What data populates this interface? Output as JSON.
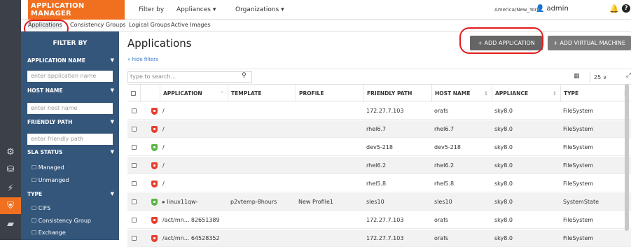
{
  "app": {
    "title": "APPLICATION MANAGER"
  },
  "topnav": {
    "filter_by": "Filter by",
    "appliances": "Appliances ▾",
    "organizations": "Organizations ▾",
    "timezone": "America/New_York",
    "user": "admin"
  },
  "subnav": {
    "tabs": [
      "Applications",
      "Consistency Groups",
      "Logical Groups",
      "Active Images"
    ]
  },
  "filters": {
    "title": "FILTER BY",
    "sections": [
      {
        "label": "APPLICATION NAME",
        "placeholder": "enter application name"
      },
      {
        "label": "HOST NAME",
        "placeholder": "enter host name"
      },
      {
        "label": "FRIENDLY PATH",
        "placeholder": "enter friendly path"
      }
    ],
    "sla_status": {
      "label": "SLA STATUS",
      "options": [
        "☐ Managed",
        "☐ Unmanged"
      ]
    },
    "type": {
      "label": "TYPE",
      "options": [
        "☐ CIFS",
        "☐ Consistency Group",
        "☐ Exchange"
      ]
    }
  },
  "main": {
    "title": "Applications",
    "hide_filters": "« hide filters",
    "add_application": "+ ADD APPLICATION",
    "add_vm": "+ ADD VIRTUAL MACHINE",
    "search_placeholder": "type to search...",
    "page_size": "25 ∨"
  },
  "table": {
    "columns": [
      "APPLICATION",
      "TEMPLATE",
      "PROFILE",
      "FRIENDLY PATH",
      "HOST NAME",
      "APPLIANCE",
      "TYPE"
    ],
    "rows": [
      {
        "status": "red",
        "application": "/",
        "template": "",
        "profile": "",
        "friendly_path": "172.27.7.103",
        "host": "orafs",
        "appliance": "sky8.0",
        "type": "FileSystem"
      },
      {
        "status": "red",
        "application": "/",
        "template": "",
        "profile": "",
        "friendly_path": "rhel6.7",
        "host": "rhel6.7",
        "appliance": "sky8.0",
        "type": "FileSystem"
      },
      {
        "status": "green",
        "application": "/",
        "template": "",
        "profile": "",
        "friendly_path": "dev5-218",
        "host": "dev5-218",
        "appliance": "sky8.0",
        "type": "FileSystem"
      },
      {
        "status": "red",
        "application": "/",
        "template": "",
        "profile": "",
        "friendly_path": "rhel6.2",
        "host": "rhel6.2",
        "appliance": "sky8.0",
        "type": "FileSystem"
      },
      {
        "status": "red",
        "application": "/",
        "template": "",
        "profile": "",
        "friendly_path": "rhel5.8",
        "host": "rhel5.8",
        "appliance": "sky8.0",
        "type": "FileSystem"
      },
      {
        "status": "green",
        "application": "▸ linux11qw-",
        "template": "p2vtemp-8hours",
        "profile": "New Profile1",
        "friendly_path": "sles10",
        "host": "sles10",
        "appliance": "sky8.0",
        "type": "SystemState"
      },
      {
        "status": "red",
        "application": "/act/mn... 82651389",
        "template": "",
        "profile": "",
        "friendly_path": "172.27.7.103",
        "host": "orafs",
        "appliance": "sky8.0",
        "type": "FileSystem"
      },
      {
        "status": "red",
        "application": "/act/mn... 64528352",
        "template": "",
        "profile": "",
        "friendly_path": "172.27.7.103",
        "host": "orafs",
        "appliance": "sky8.0",
        "type": "FileSystem"
      }
    ]
  }
}
